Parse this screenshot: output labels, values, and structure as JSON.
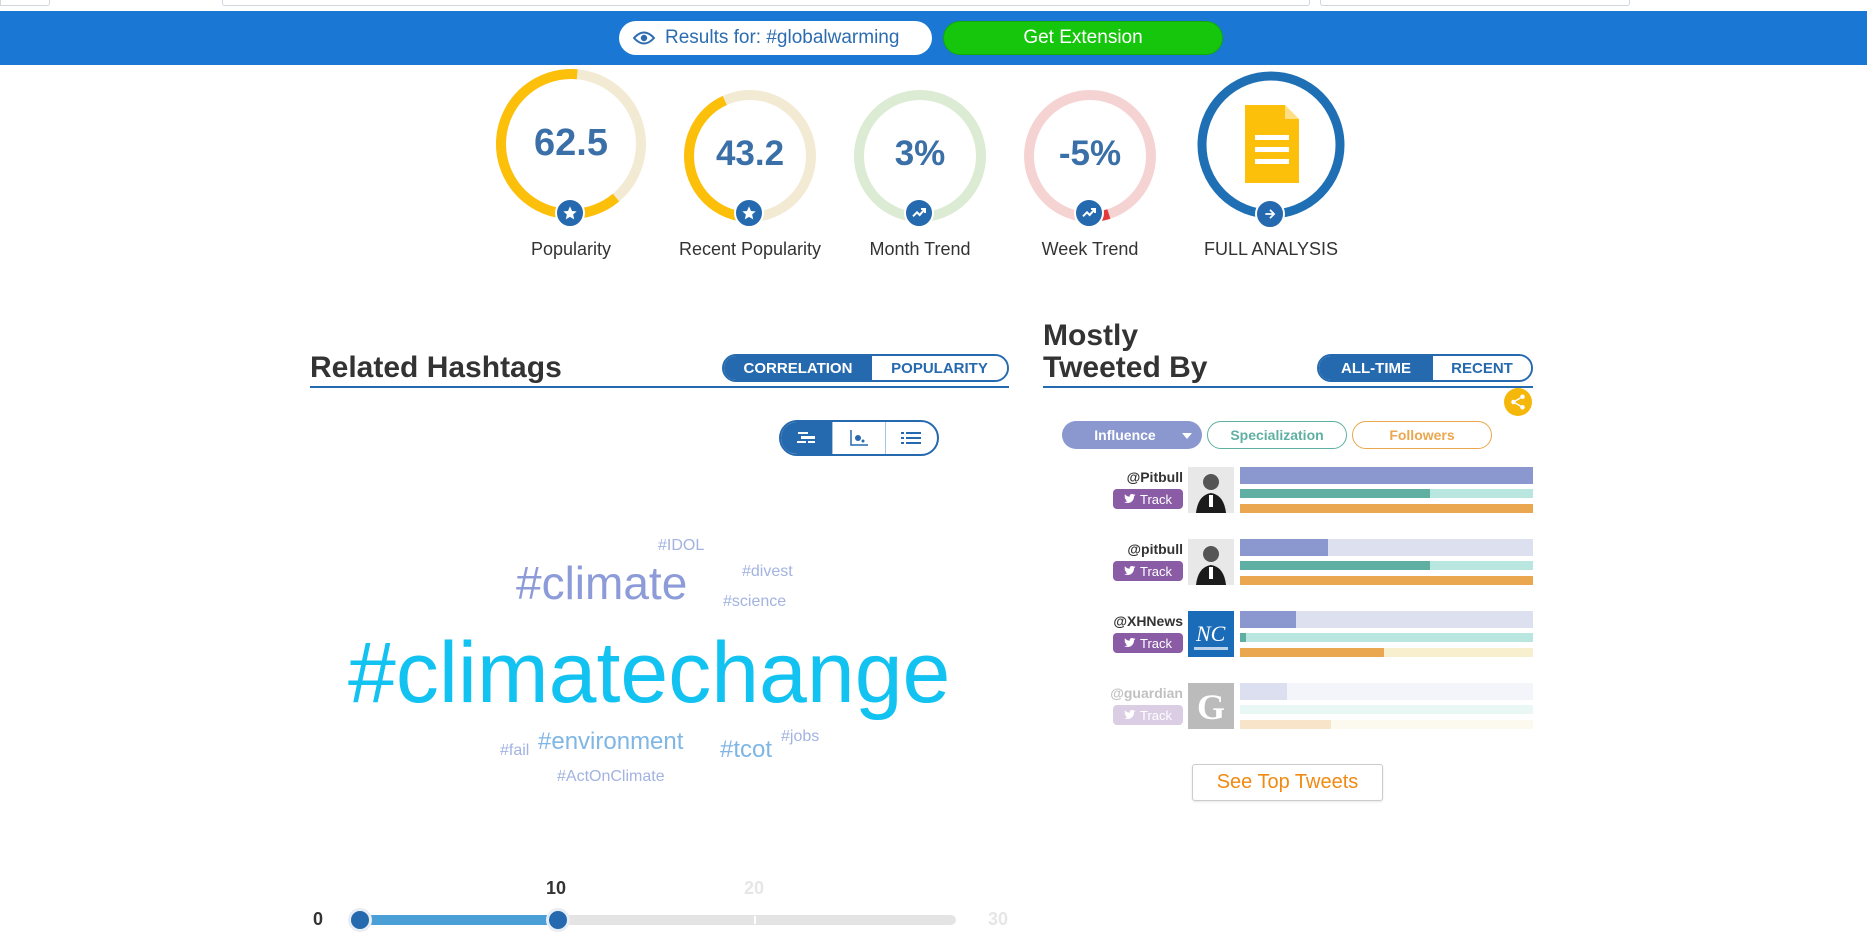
{
  "header": {
    "results_label": "Results for: #globalwarming",
    "extension_label": "Get Extension"
  },
  "gauges": [
    {
      "label": "Popularity",
      "value": "62.5",
      "fraction": 0.625,
      "icon": "star-icon"
    },
    {
      "label": "Recent Popularity",
      "value": "43.2",
      "fraction": 0.432,
      "icon": "star-icon"
    },
    {
      "label": "Month Trend",
      "value": "3%",
      "fraction": 0.03,
      "icon": "trend-up-icon"
    },
    {
      "label": "Week Trend",
      "value": "-5%",
      "fraction": 0.05,
      "icon": "trend-up-icon"
    },
    {
      "label": "FULL ANALYSIS",
      "icon": "document-icon"
    }
  ],
  "related": {
    "title": "Related Hashtags",
    "tab_correlation": "CORRELATION",
    "tab_popularity": "POPULARITY",
    "words": [
      {
        "text": "#IDOL",
        "color": "#a3b3e0"
      },
      {
        "text": "#climate",
        "color": "#8d9cd8"
      },
      {
        "text": "#divest",
        "color": "#a3b3e0"
      },
      {
        "text": "#science",
        "color": "#a3b3e0"
      },
      {
        "text": "#climatechange",
        "color": "#12c2f0"
      },
      {
        "text": "#fail",
        "color": "#a3b3e0"
      },
      {
        "text": "#environment",
        "color": "#7fb6e4"
      },
      {
        "text": "#tcot",
        "color": "#7fb6e4"
      },
      {
        "text": "#jobs",
        "color": "#a3b3e0"
      },
      {
        "text": "#ActOnClimate",
        "color": "#a3b3e0"
      }
    ],
    "slider": {
      "min": "0",
      "value": "10",
      "mid": "20",
      "max": "30"
    }
  },
  "tweeted": {
    "title_line1": "Mostly",
    "title_line2": "Tweeted By",
    "tab_alltime": "ALL-TIME",
    "tab_recent": "RECENT",
    "seg_influence": "Influence",
    "seg_specialization": "Specialization",
    "seg_followers": "Followers",
    "track_label": "Track",
    "rows": [
      {
        "name": "@Pitbull",
        "influence": 1.0,
        "specialization": 0.65,
        "followers": 1.0
      },
      {
        "name": "@pitbull",
        "influence": 0.3,
        "specialization": 0.65,
        "followers": 1.0
      },
      {
        "name": "@XHNews",
        "influence": 0.19,
        "specialization": 0.02,
        "followers": 0.49
      },
      {
        "name": "@guardian",
        "influence": 0.16,
        "specialization": 0.0,
        "followers": 0.31
      }
    ],
    "see_top_tweets": "See Top Tweets"
  },
  "colors": {
    "brand_blue": "#1a78d4",
    "dark_blue": "#2569ae",
    "green": "#16c60c",
    "gauge_yellow": "#fcbf0a",
    "influence": "#8a98cf",
    "specialization": "#5fb0a3",
    "followers": "#eba74f"
  }
}
